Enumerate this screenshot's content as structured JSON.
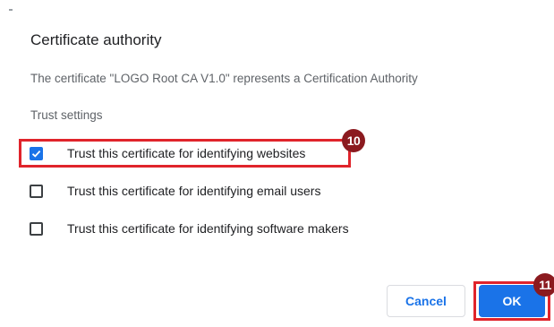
{
  "dialog": {
    "title": "Certificate authority",
    "description": "The certificate \"LOGO Root CA V1.0\" represents a Certification Authority",
    "section_label": "Trust settings",
    "options": [
      {
        "label": "Trust this certificate for identifying websites",
        "checked": true
      },
      {
        "label": "Trust this certificate for identifying email users",
        "checked": false
      },
      {
        "label": "Trust this certificate for identifying software makers",
        "checked": false
      }
    ],
    "buttons": {
      "cancel_label": "Cancel",
      "ok_label": "OK"
    }
  },
  "annotations": {
    "step_10": "10",
    "step_11": "11"
  },
  "colors": {
    "accent": "#1a73e8",
    "highlight": "#e0242b",
    "badge": "#8b1a1f"
  }
}
